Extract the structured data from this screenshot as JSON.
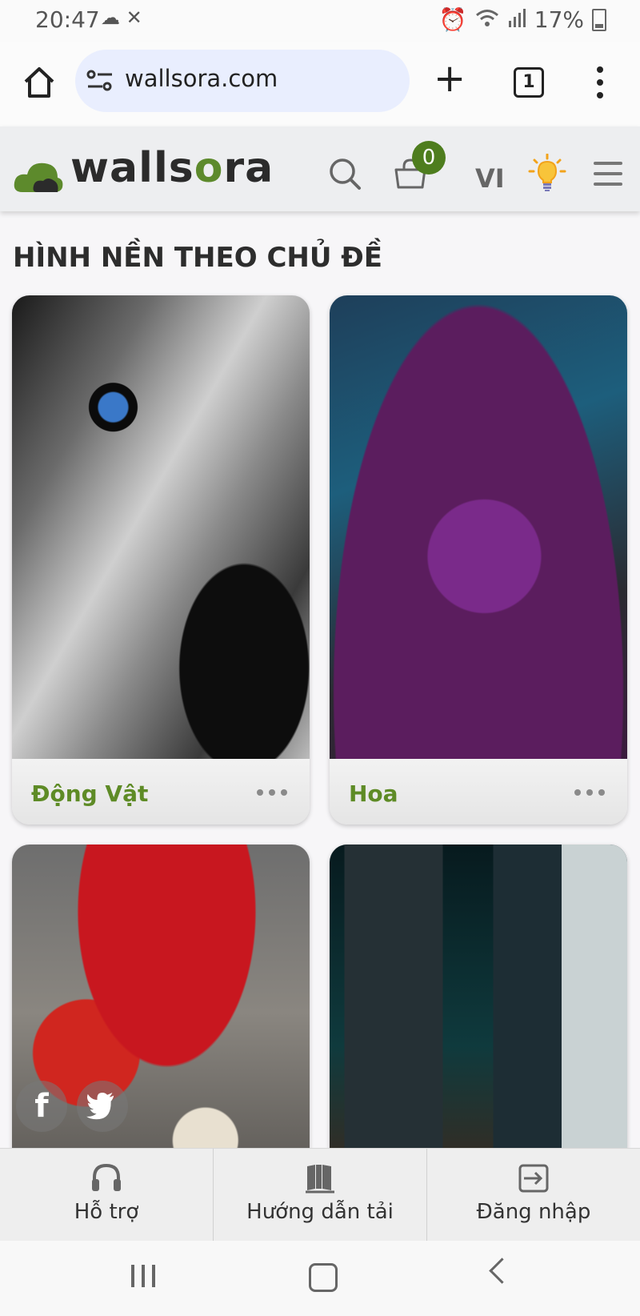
{
  "status": {
    "time": "20:47",
    "battery": "17%"
  },
  "browser": {
    "url": "wallsora.com",
    "tab_count": "1"
  },
  "site": {
    "logo_prefix": "walls",
    "logo_o": "o",
    "logo_suffix": "ra",
    "cart_count": "0",
    "language": "VI"
  },
  "section_title": "HÌNH NỀN THEO CHỦ ĐỀ",
  "categories": [
    {
      "label": "Động Vật"
    },
    {
      "label": "Hoa"
    },
    {
      "label": ""
    },
    {
      "label": ""
    }
  ],
  "social": {
    "facebook": "f",
    "twitter": "t"
  },
  "bottom_nav": [
    {
      "label": "Hỗ trợ",
      "icon": "headphones-icon"
    },
    {
      "label": "Hướng dẫn tải",
      "icon": "book-icon"
    },
    {
      "label": "Đăng nhập",
      "icon": "login-icon"
    }
  ]
}
